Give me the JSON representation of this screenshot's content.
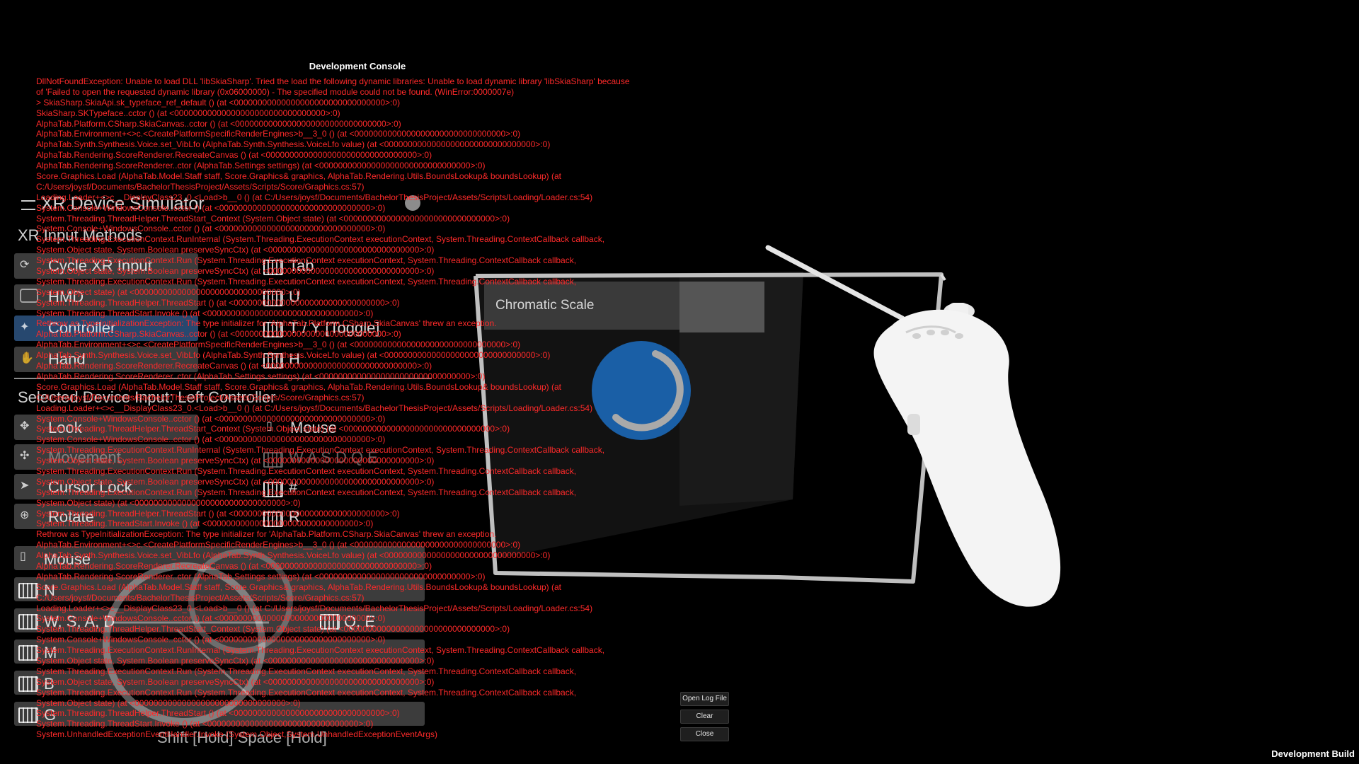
{
  "scene": {
    "panel_title": "Chromatic Scale"
  },
  "simulator": {
    "title": "XR Device Simulator",
    "input_methods_header": "XR Input Methods",
    "input_methods": [
      {
        "label": "Cycle XR Input",
        "icon": "cycle-input-icon",
        "key": "Tab"
      },
      {
        "label": "HMD",
        "icon": "hmd-icon",
        "key": "U"
      },
      {
        "label": "Controller",
        "icon": "controller-icon",
        "key": "T / Y [Toggle]",
        "selected": true
      },
      {
        "label": "Hand",
        "icon": "hand-icon",
        "key": "H"
      }
    ],
    "selected_device": "Selected Device Input: Left Controller",
    "controls": [
      {
        "label": "Look",
        "icon": "look-icon",
        "key": "Mouse"
      },
      {
        "label": "Movement",
        "icon": "movement-icon",
        "key": "W A S D Q E"
      },
      {
        "label": "Cursor Lock",
        "icon": "cursor-icon",
        "key": "#"
      },
      {
        "label": "Rotate",
        "icon": "rotate-icon",
        "key": "R"
      }
    ],
    "bindings": [
      {
        "label": "Mouse",
        "icon": "mouse-icon"
      },
      {
        "label": "N",
        "icon": "keyboard-icon"
      },
      {
        "label": "W, S, A, D",
        "icon": "keyboard-icon",
        "secondary": "Q, E"
      },
      {
        "label": "M",
        "icon": "keyboard-icon"
      },
      {
        "label": "B",
        "icon": "keyboard-icon"
      },
      {
        "label": "G",
        "icon": "keyboard-icon"
      }
    ],
    "footer_keys": "Shift [Hold]   Space [Hold]"
  },
  "console": {
    "title": "Development Console",
    "lines": [
      "DllNotFoundException: Unable to load DLL 'libSkiaSharp'. Tried the load the following dynamic libraries: Unable to load dynamic library 'libSkiaSharp' because",
      "of 'Failed to open the requested dynamic library (0x06000000) - The specified module could not be found.  (WinError:0000007e)",
      "> SkiaSharp.SkiaApi.sk_typeface_ref_default () (at <00000000000000000000000000000000>:0)",
      "SkiaSharp.SKTypeface..cctor () (at <00000000000000000000000000000000>:0)",
      "AlphaTab.Platform.CSharp.SkiaCanvas..cctor () (at <00000000000000000000000000000000>:0)",
      "AlphaTab.Environment+<>c.<CreatePlatformSpecificRenderEngines>b__3_0 () (at <00000000000000000000000000000000>:0)",
      "AlphaTab.Synth.Synthesis.Voice.set_VibLfo (AlphaTab.Synth.Synthesis.VoiceLfo value) (at <00000000000000000000000000000000>:0)",
      "AlphaTab.Rendering.ScoreRenderer.RecreateCanvas () (at <00000000000000000000000000000000>:0)",
      "AlphaTab.Rendering.ScoreRenderer..ctor (AlphaTab.Settings settings) (at <00000000000000000000000000000000>:0)",
      "Score.Graphics.Load (AlphaTab.Model.Staff staff, Score.Graphics& graphics, AlphaTab.Rendering.Utils.BoundsLookup& boundsLookup) (at",
      "C:/Users/joysf/Documents/BachelorThesisProject/Assets/Scripts/Score/Graphics.cs:57)",
      "Loading.Loader+<>c__DisplayClass23_0.<Load>b__0 () (at C:/Users/joysf/Documents/BachelorThesisProject/Assets/Scripts/Loading/Loader.cs:54)",
      "System.Console+WindowsConsole..cctor () (at <00000000000000000000000000000000>:0)",
      "System.Threading.ThreadHelper.ThreadStart_Context (System.Object state) (at <00000000000000000000000000000000>:0)",
      "System.Console+WindowsConsole..cctor () (at <00000000000000000000000000000000>:0)",
      "System.Threading.ExecutionContext.RunInternal (System.Threading.ExecutionContext executionContext, System.Threading.ContextCallback callback,",
      "System.Object state, System.Boolean preserveSyncCtx) (at <00000000000000000000000000000000>:0)",
      "System.Threading.ExecutionContext.Run (System.Threading.ExecutionContext executionContext, System.Threading.ContextCallback callback,",
      "System.Object state, System.Boolean preserveSyncCtx) (at <00000000000000000000000000000000>:0)",
      "System.Threading.ExecutionContext.Run (System.Threading.ExecutionContext executionContext, System.Threading.ContextCallback callback,",
      "System.Object state) (at <00000000000000000000000000000000>:0)",
      "System.Threading.ThreadHelper.ThreadStart () (at <00000000000000000000000000000000>:0)",
      "System.Threading.ThreadStart.Invoke () (at <00000000000000000000000000000000>:0)",
      "Rethrow as TypeInitializationException: The type initializer for 'AlphaTab.Platform.CSharp.SkiaCanvas' threw an exception.",
      "AlphaTab.Platform.CSharp.SkiaCanvas..cctor () (at <00000000000000000000000000000000>:0)",
      "AlphaTab.Environment+<>c.<CreatePlatformSpecificRenderEngines>b__3_0 () (at <00000000000000000000000000000000>:0)",
      "AlphaTab.Synth.Synthesis.Voice.set_VibLfo (AlphaTab.Synth.Synthesis.VoiceLfo value) (at <00000000000000000000000000000000>:0)",
      "AlphaTab.Rendering.ScoreRenderer.RecreateCanvas () (at <00000000000000000000000000000000>:0)",
      "AlphaTab.Rendering.ScoreRenderer..ctor (AlphaTab.Settings settings) (at <00000000000000000000000000000000>:0)",
      "Score.Graphics.Load (AlphaTab.Model.Staff staff, Score.Graphics& graphics, AlphaTab.Rendering.Utils.BoundsLookup& boundsLookup) (at",
      "C:/Users/joysf/Documents/BachelorThesisProject/Assets/Scripts/Score/Graphics.cs:57)",
      "Loading.Loader+<>c__DisplayClass23_0.<Load>b__0 () (at C:/Users/joysf/Documents/BachelorThesisProject/Assets/Scripts/Loading/Loader.cs:54)",
      "System.Console+WindowsConsole..cctor () (at <00000000000000000000000000000000>:0)",
      "System.Threading.ThreadHelper.ThreadStart_Context (System.Object state) (at <00000000000000000000000000000000>:0)",
      "System.Console+WindowsConsole..cctor () (at <00000000000000000000000000000000>:0)",
      "System.Threading.ExecutionContext.RunInternal (System.Threading.ExecutionContext executionContext, System.Threading.ContextCallback callback,",
      "System.Object state, System.Boolean preserveSyncCtx) (at <00000000000000000000000000000000>:0)",
      "System.Threading.ExecutionContext.Run (System.Threading.ExecutionContext executionContext, System.Threading.ContextCallback callback,",
      "System.Object state, System.Boolean preserveSyncCtx) (at <00000000000000000000000000000000>:0)",
      "System.Threading.ExecutionContext.Run (System.Threading.ExecutionContext executionContext, System.Threading.ContextCallback callback,",
      "System.Object state) (at <00000000000000000000000000000000>:0)",
      "System.Threading.ThreadHelper.ThreadStart () (at <00000000000000000000000000000000>:0)",
      "System.Threading.ThreadStart.Invoke () (at <00000000000000000000000000000000>:0)",
      "Rethrow as TypeInitializationException: The type initializer for 'AlphaTab.Platform.CSharp.SkiaCanvas' threw an exception.",
      "AlphaTab.Environment+<>c.<CreatePlatformSpecificRenderEngines>b__3_0 () (at <00000000000000000000000000000000>:0)",
      "AlphaTab.Synth.Synthesis.Voice.set_VibLfo (AlphaTab.Synth.Synthesis.VoiceLfo value) (at <00000000000000000000000000000000>:0)",
      "AlphaTab.Rendering.ScoreRenderer.RecreateCanvas () (at <00000000000000000000000000000000>:0)",
      "AlphaTab.Rendering.ScoreRenderer..ctor (AlphaTab.Settings settings) (at <00000000000000000000000000000000>:0)",
      "Score.Graphics.Load (AlphaTab.Model.Staff staff, Score.Graphics& graphics, AlphaTab.Rendering.Utils.BoundsLookup& boundsLookup) (at",
      "C:/Users/joysf/Documents/BachelorThesisProject/Assets/Scripts/Score/Graphics.cs:57)",
      "Loading.Loader+<>c__DisplayClass23_0.<Load>b__0 () (at C:/Users/joysf/Documents/BachelorThesisProject/Assets/Scripts/Loading/Loader.cs:54)",
      "System.Console+WindowsConsole..cctor () (at <00000000000000000000000000000000>:0)",
      "System.Threading.ThreadHelper.ThreadStart_Context (System.Object state) (at <00000000000000000000000000000000>:0)",
      "System.Console+WindowsConsole..cctor () (at <00000000000000000000000000000000>:0)",
      "System.Threading.ExecutionContext.RunInternal (System.Threading.ExecutionContext executionContext, System.Threading.ContextCallback callback,",
      "System.Object state, System.Boolean preserveSyncCtx) (at <00000000000000000000000000000000>:0)",
      "System.Threading.ExecutionContext.Run (System.Threading.ExecutionContext executionContext, System.Threading.ContextCallback callback,",
      "System.Object state, System.Boolean preserveSyncCtx) (at <00000000000000000000000000000000>:0)",
      "System.Threading.ExecutionContext.Run (System.Threading.ExecutionContext executionContext, System.Threading.ContextCallback callback,",
      "System.Object state) (at <00000000000000000000000000000000>:0)",
      "System.Threading.ThreadHelper.ThreadStart () (at <00000000000000000000000000000000>:0)",
      "System.Threading.ThreadStart.Invoke () (at <00000000000000000000000000000000>:0)",
      "System.UnhandledExceptionEventHandler.Invoke (System.Object,System.UnhandledExceptionEventArgs)"
    ],
    "buttons": {
      "open_log": "Open Log File",
      "clear": "Clear",
      "close": "Close"
    }
  },
  "footer": {
    "build_label": "Development Build"
  }
}
